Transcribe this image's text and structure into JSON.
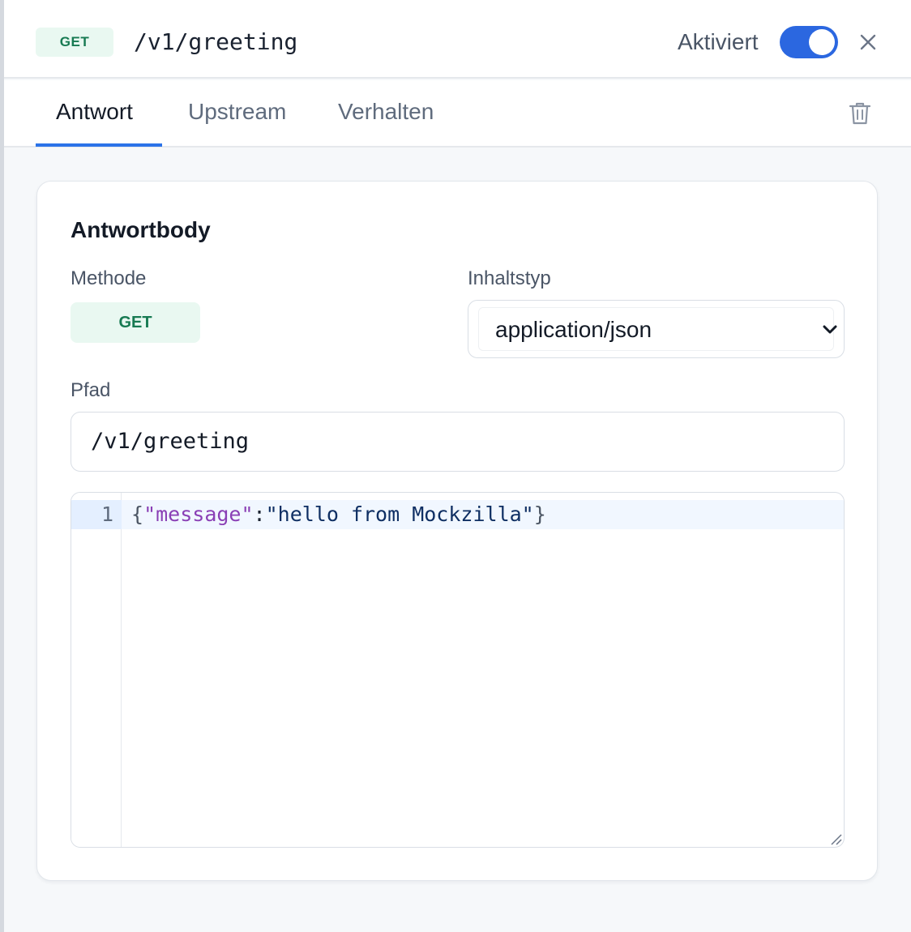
{
  "header": {
    "method": "GET",
    "path": "/v1/greeting",
    "toggle_label": "Aktiviert",
    "toggle_on": true
  },
  "tabs": [
    {
      "label": "Antwort",
      "active": true
    },
    {
      "label": "Upstream",
      "active": false
    },
    {
      "label": "Verhalten",
      "active": false
    }
  ],
  "card": {
    "title": "Antwortbody",
    "method_label": "Methode",
    "method_value": "GET",
    "content_type_label": "Inhaltstyp",
    "content_type_value": "application/json",
    "path_label": "Pfad",
    "path_value": "/v1/greeting"
  },
  "editor": {
    "line_number": "1",
    "tokens": {
      "open_brace": "{",
      "key": "\"message\"",
      "colon": ":",
      "value": "\"hello from Mockzilla\"",
      "close_brace": "}"
    }
  },
  "icons": {
    "close": "close-icon",
    "trash": "trash-icon",
    "chevron": "chevron-down-icon"
  },
  "colors": {
    "accent": "#2b67e0",
    "get_badge_bg": "#e9f8f1",
    "get_badge_text": "#177a52"
  }
}
